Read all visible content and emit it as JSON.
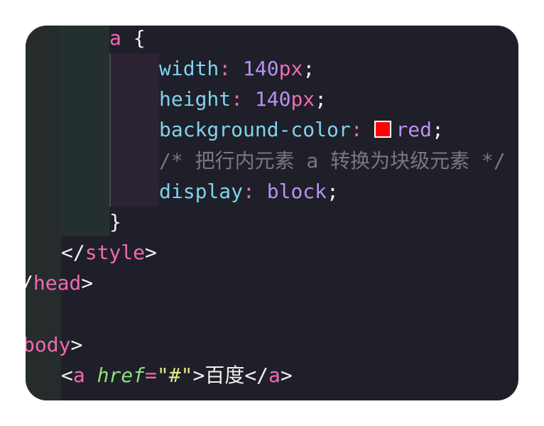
{
  "editor": {
    "lines": [
      {
        "selector": "a",
        "open_brace": " {"
      },
      {
        "property": "width",
        "colon": ": ",
        "number": "140",
        "unit": "px",
        "semicolon": ";"
      },
      {
        "property": "height",
        "colon": ": ",
        "number": "140",
        "unit": "px",
        "semicolon": ";"
      },
      {
        "property": "background-color",
        "colon": ": ",
        "value": "red",
        "semicolon": ";",
        "swatch_color": "#ff0000"
      },
      {
        "comment": "/* 把行内元素 a 转换为块级元素 */"
      },
      {
        "property": "display",
        "colon": ": ",
        "value": "block",
        "semicolon": ";"
      },
      {
        "close_brace": "}"
      },
      {
        "lt_slash": "</",
        "tag": "style",
        "gt": ">"
      },
      {
        "slash": "/",
        "tag": "head",
        "gt": ">"
      },
      {
        "tag": "body",
        "gt": ">"
      },
      {
        "lt": "<",
        "tag": "a",
        "attr": "href",
        "eq": "=",
        "quote_open": "\"",
        "attr_value": "#",
        "quote_close": "\"",
        "gt": ">",
        "text": "百度",
        "close_lt": "</",
        "close_tag": "a",
        "close_gt": ">"
      }
    ]
  },
  "colors": {
    "background": "#1f1f29",
    "tag": "#f06ab0",
    "property": "#7fd2ec",
    "number": "#b990f0",
    "comment": "#777785",
    "attribute": "#8fe07a",
    "string": "#e8e88a"
  }
}
